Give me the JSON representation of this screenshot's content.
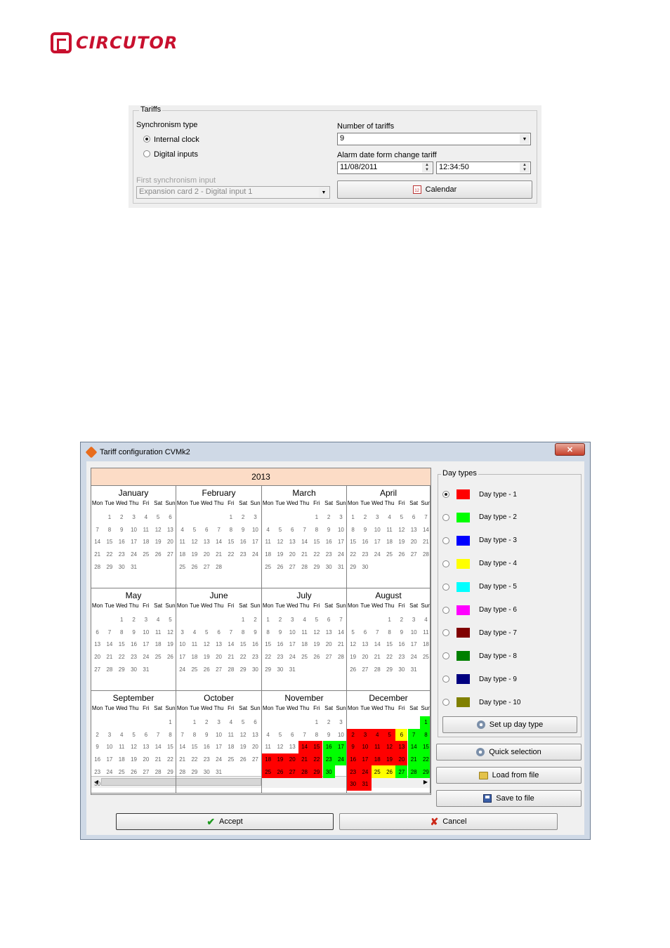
{
  "brand": {
    "name": "CIRCUTOR"
  },
  "tariffs": {
    "group_title": "Tariffs",
    "sync_type_label": "Synchronism type",
    "internal_clock_label": "Internal clock",
    "digital_inputs_label": "Digital inputs",
    "first_sync_label": "First synchronism input",
    "first_sync_value": "Expansion card 2 - Digital input 1",
    "num_tariffs_label": "Number of tariffs",
    "num_tariffs_value": "9",
    "alarm_label": "Alarm date form change tariff",
    "alarm_date": "11/08/2011",
    "alarm_time": "12:34:50",
    "calendar_button": "Calendar",
    "calendar_icon_text": "12"
  },
  "dialog": {
    "title": "Tariff configuration CVMk2",
    "close_label": "✕",
    "year": "2013",
    "dow_labels": [
      "Mon",
      "Tue",
      "Wed",
      "Thu",
      "Fri",
      "Sat",
      "Sun"
    ],
    "months": [
      {
        "name": "January",
        "first": 1,
        "days": 31
      },
      {
        "name": "February",
        "first": 4,
        "days": 28
      },
      {
        "name": "March",
        "first": 4,
        "days": 31
      },
      {
        "name": "April",
        "first": 0,
        "days": 30
      },
      {
        "name": "May",
        "first": 2,
        "days": 31
      },
      {
        "name": "June",
        "first": 5,
        "days": 30
      },
      {
        "name": "July",
        "first": 0,
        "days": 31
      },
      {
        "name": "August",
        "first": 3,
        "days": 31
      },
      {
        "name": "September",
        "first": 6,
        "days": 30
      },
      {
        "name": "October",
        "first": 1,
        "days": 31
      },
      {
        "name": "November",
        "first": 4,
        "days": 30
      },
      {
        "name": "December",
        "first": 6,
        "days": 31
      }
    ],
    "day_colors": {
      "November": {
        "14": "#ff0000",
        "15": "#ff0000",
        "16": "#00ff00",
        "17": "#00ff00",
        "18": "#ff0000",
        "19": "#ff0000",
        "20": "#ff0000",
        "21": "#ff0000",
        "22": "#ff0000",
        "23": "#00ff00",
        "24": "#00ff00",
        "25": "#ff0000",
        "26": "#ff0000",
        "27": "#ff0000",
        "28": "#ff0000",
        "29": "#ff0000",
        "30": "#00ff00"
      },
      "December": {
        "1": "#00ff00",
        "2": "#ff0000",
        "3": "#ff0000",
        "4": "#ff0000",
        "5": "#ff0000",
        "6": "#ffff00",
        "7": "#00ff00",
        "8": "#00ff00",
        "9": "#ff0000",
        "10": "#ff0000",
        "11": "#ff0000",
        "12": "#ff0000",
        "13": "#ff0000",
        "14": "#00ff00",
        "15": "#00ff00",
        "16": "#ff0000",
        "17": "#ff0000",
        "18": "#ff0000",
        "19": "#ff0000",
        "20": "#ff0000",
        "21": "#00ff00",
        "22": "#00ff00",
        "23": "#ff0000",
        "24": "#ff0000",
        "25": "#ffff00",
        "26": "#ffff00",
        "27": "#00ff00",
        "28": "#00ff00",
        "29": "#00ff00",
        "30": "#ff0000",
        "31": "#ff0000"
      }
    },
    "day_types_title": "Day types",
    "day_types": [
      {
        "label": "Day type - 1",
        "color": "#ff0000",
        "selected": true
      },
      {
        "label": "Day type - 2",
        "color": "#00ff00"
      },
      {
        "label": "Day type - 3",
        "color": "#0000ff"
      },
      {
        "label": "Day type - 4",
        "color": "#ffff00"
      },
      {
        "label": "Day type - 5",
        "color": "#00ffff"
      },
      {
        "label": "Day type - 6",
        "color": "#ff00ff"
      },
      {
        "label": "Day type - 7",
        "color": "#800000"
      },
      {
        "label": "Day type - 8",
        "color": "#008000"
      },
      {
        "label": "Day type - 9",
        "color": "#000080"
      },
      {
        "label": "Day type - 10",
        "color": "#808000"
      }
    ],
    "setup_button": "Set up day type",
    "quick_selection_button": "Quick selection",
    "load_button": "Load from file",
    "save_button": "Save to file",
    "accept_button": "Accept",
    "cancel_button": "Cancel"
  }
}
